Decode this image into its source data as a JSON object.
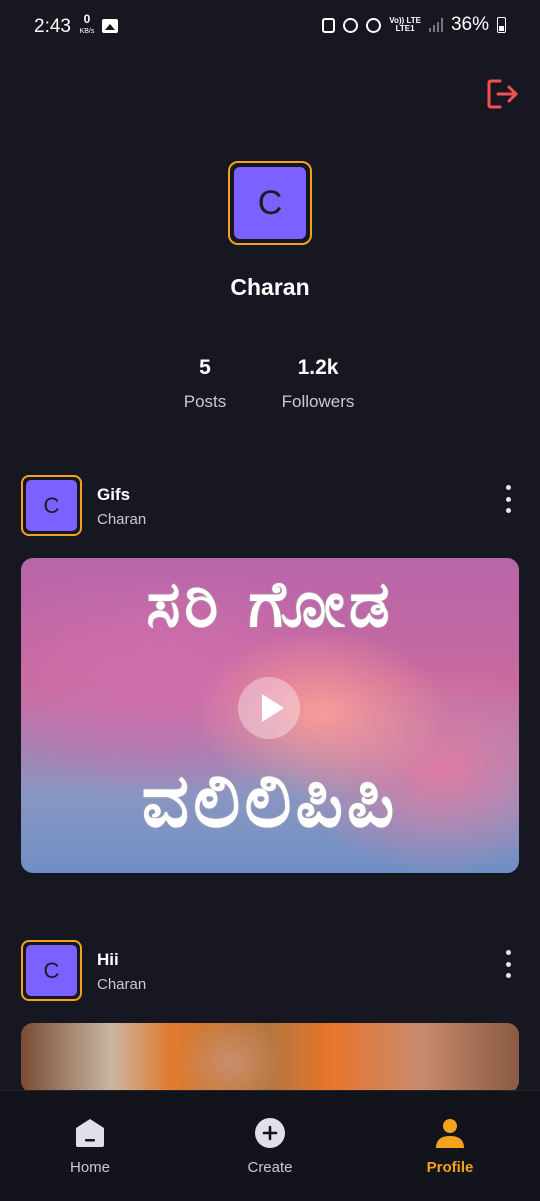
{
  "status_bar": {
    "time": "2:43",
    "net_speed_value": "0",
    "net_speed_unit": "KB/s",
    "network_label_top": "Vo)) LTE",
    "network_label_bottom": "LTE1",
    "battery": "36%"
  },
  "profile": {
    "avatar_initial": "C",
    "name": "Charan",
    "stats": {
      "posts_count": "5",
      "posts_label": "Posts",
      "followers_count": "1.2k",
      "followers_label": "Followers"
    }
  },
  "posts": [
    {
      "avatar_initial": "C",
      "title": "Gifs",
      "author": "Charan",
      "overlay_line1": "ಸರಿ ಗೋಡ",
      "overlay_line2": "ವಲಿಲಿಪಿಪಿ"
    },
    {
      "avatar_initial": "C",
      "title": "Hii",
      "author": "Charan"
    }
  ],
  "bottom_nav": {
    "home": "Home",
    "create": "Create",
    "profile": "Profile",
    "active": "profile"
  },
  "colors": {
    "background": "#171721",
    "accent": "#f3a31b",
    "avatar": "#7b61ff",
    "logout": "#f05252"
  }
}
